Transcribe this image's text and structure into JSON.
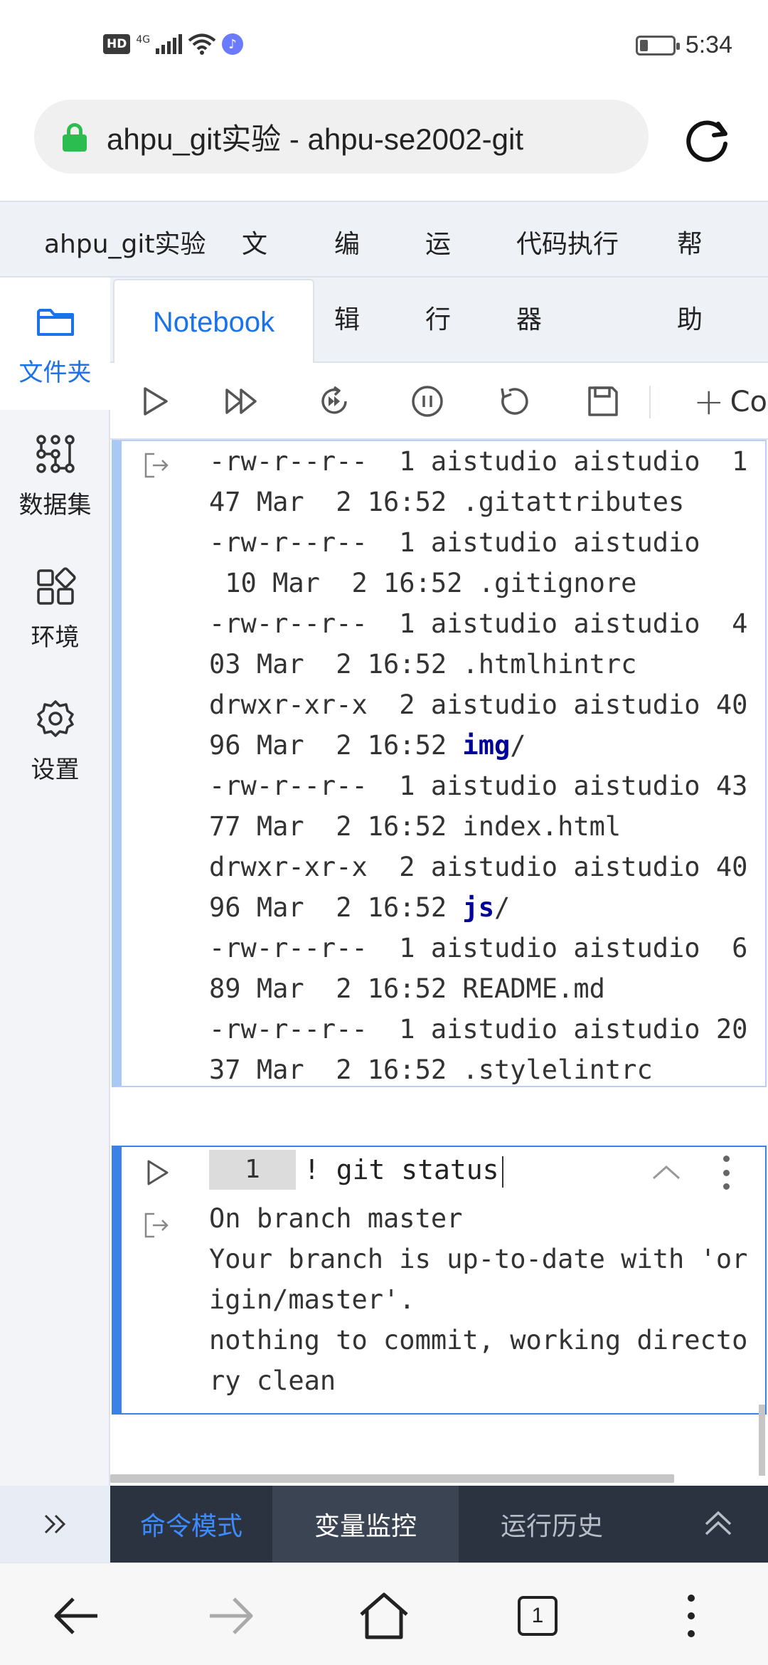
{
  "status_bar": {
    "hd": "HD",
    "network": "4G",
    "time": "5:34",
    "battery_level": 0.25
  },
  "browser": {
    "url_title": "ahpu_git实验 - ahpu-se2002-git",
    "tabs_count": "1"
  },
  "menubar": {
    "project": "ahpu_git实验",
    "file_1": "文",
    "edit_1": "编",
    "run_1": "运",
    "code_exec": "代码执行",
    "help_1": "帮"
  },
  "tabrow": {
    "notebook": "Notebook",
    "edit_2": "辑",
    "run_2": "行",
    "code_exec_2": "器",
    "help_2": "助"
  },
  "toolbar": {
    "add_code": "Coc"
  },
  "sidebar": {
    "items": [
      {
        "label": "文件夹",
        "icon": "folder-icon"
      },
      {
        "label": "数据集",
        "icon": "dataset-icon"
      },
      {
        "label": "环境",
        "icon": "environment-icon"
      },
      {
        "label": "设置",
        "icon": "settings-icon"
      }
    ]
  },
  "cell1": {
    "output_lines": [
      {
        "text": "-rw-r--r--  1 aistudio aistudio  1"
      },
      {
        "text": "47 Mar  2 16:52 .gitattributes"
      },
      {
        "text": "-rw-r--r--  1 aistudio aistudio "
      },
      {
        "text": " 10 Mar  2 16:52 .gitignore"
      },
      {
        "text": "-rw-r--r--  1 aistudio aistudio  4"
      },
      {
        "text": "03 Mar  2 16:52 .htmlhintrc"
      },
      {
        "text": "drwxr-xr-x  2 aistudio aistudio 40"
      },
      {
        "text": "96 Mar  2 16:52 ",
        "dir": "img",
        "suffix": "/"
      },
      {
        "text": "-rw-r--r--  1 aistudio aistudio 43"
      },
      {
        "text": "77 Mar  2 16:52 index.html"
      },
      {
        "text": "drwxr-xr-x  2 aistudio aistudio 40"
      },
      {
        "text": "96 Mar  2 16:52 ",
        "dir": "js",
        "suffix": "/"
      },
      {
        "text": "-rw-r--r--  1 aistudio aistudio  6"
      },
      {
        "text": "89 Mar  2 16:52 README.md"
      },
      {
        "text": "-rw-r--r--  1 aistudio aistudio 20"
      },
      {
        "text": "37 Mar  2 16:52 .stylelintrc"
      }
    ]
  },
  "cell2": {
    "line_number": "1",
    "code": "! git status",
    "output_lines": [
      "On branch master",
      "Your branch is up-to-date with 'or",
      "igin/master'.",
      "nothing to commit, working directo",
      "ry clean"
    ]
  },
  "panel": {
    "command_mode": "命令模式",
    "variable_monitor": "变量监控",
    "run_history": "运行历史"
  },
  "colors": {
    "accent": "#1a73e8",
    "lock_green": "#2bbd4f",
    "panel_bg": "#2b3340",
    "dir_blue": "#00009a"
  }
}
